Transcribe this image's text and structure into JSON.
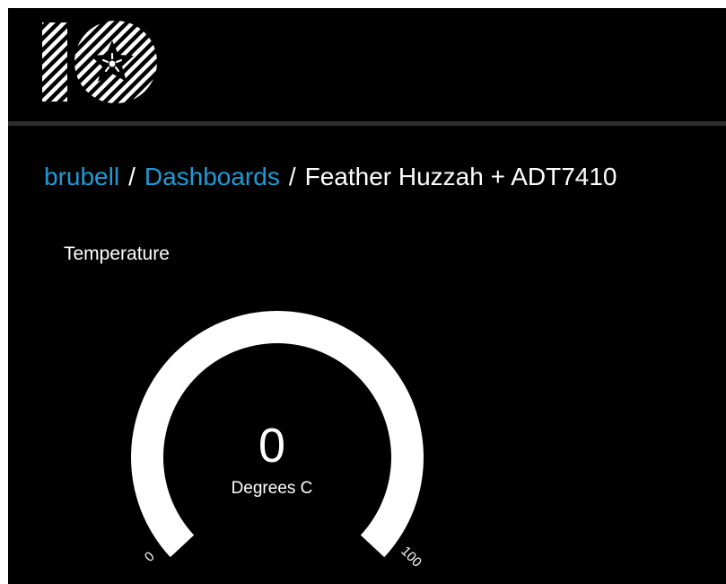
{
  "app": {
    "logo_name": "adafruit-io-logo",
    "header_bg": "#000000",
    "accent_color": "#1e9bd7"
  },
  "breadcrumb": {
    "user": "brubell",
    "separator_1": "/",
    "section": "Dashboards",
    "separator_2": "/",
    "current": "Feather Huzzah + ADT7410"
  },
  "block": {
    "title": "Temperature",
    "gauge": {
      "value": "0",
      "value_numeric": 0,
      "unit": "Degrees C",
      "min_label": "0",
      "max_label": "100",
      "min": 0,
      "max": 100,
      "fill_color": "#ffffff"
    }
  }
}
